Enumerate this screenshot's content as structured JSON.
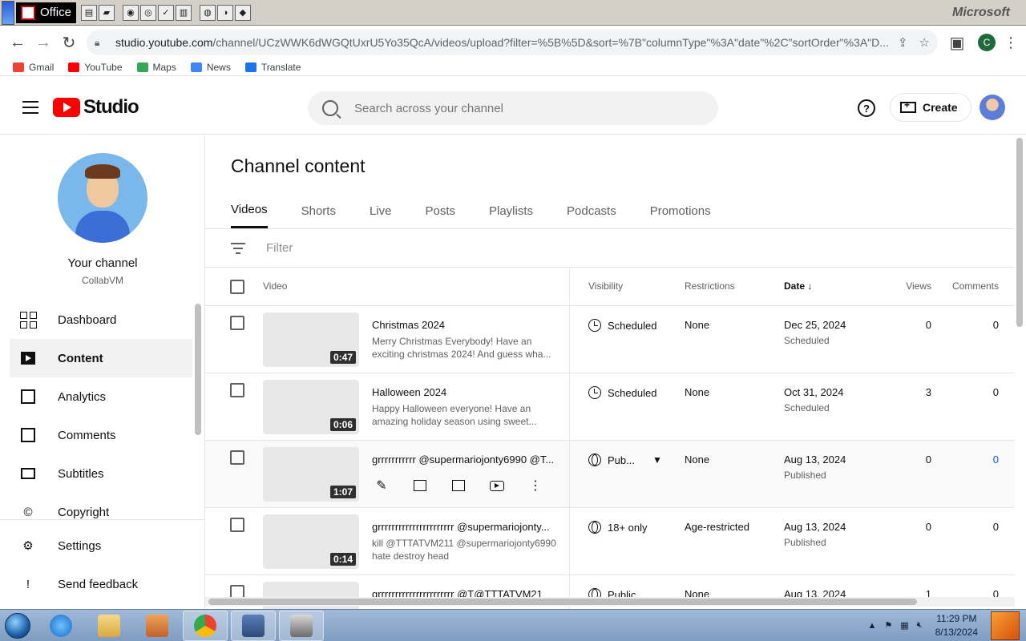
{
  "office": {
    "button_label": "Office",
    "brand": "Microsoft"
  },
  "browser": {
    "url_host": "studio.youtube.com",
    "url_path": "/channel/UCzWWK6dWGQtUxrU5Yo35QcA/videos/upload?filter=%5B%5D&sort=%7B\"columnType\"%3A\"date\"%2C\"sortOrder\"%3A\"D...",
    "profile_initial": "C",
    "bookmarks": [
      "Gmail",
      "YouTube",
      "Maps",
      "News",
      "Translate"
    ]
  },
  "header": {
    "logo_text": "Studio",
    "search_placeholder": "Search across your channel",
    "help": "?",
    "create_label": "Create"
  },
  "sidebar": {
    "channel_name": "Your channel",
    "channel_handle": "CollabVM",
    "items": [
      {
        "label": "Dashboard",
        "icon": "dashboard-icon",
        "active": false
      },
      {
        "label": "Content",
        "icon": "content-icon",
        "active": true
      },
      {
        "label": "Analytics",
        "icon": "analytics-icon",
        "active": false
      },
      {
        "label": "Comments",
        "icon": "comments-icon",
        "active": false
      },
      {
        "label": "Subtitles",
        "icon": "subtitles-icon",
        "active": false
      },
      {
        "label": "Copyright",
        "icon": "copyright-icon",
        "active": false
      }
    ],
    "bottom_items": [
      {
        "label": "Settings",
        "icon": "gear-icon"
      },
      {
        "label": "Send feedback",
        "icon": "feedback-icon"
      }
    ]
  },
  "main": {
    "title": "Channel content",
    "tabs": [
      "Videos",
      "Shorts",
      "Live",
      "Posts",
      "Playlists",
      "Podcasts",
      "Promotions"
    ],
    "active_tab": "Videos",
    "filter_placeholder": "Filter",
    "columns": {
      "video": "Video",
      "visibility": "Visibility",
      "restrictions": "Restrictions",
      "date": "Date",
      "views": "Views",
      "comments": "Comments"
    },
    "rows": [
      {
        "duration": "0:47",
        "title": "Christmas 2024",
        "description": "Merry Christmas Everybody! Have an exciting christmas 2024! And guess wha...",
        "visibility": "Scheduled",
        "restrictions": "None",
        "date": "Dec 25, 2024",
        "date_status": "Scheduled",
        "views": "0",
        "comments": "0"
      },
      {
        "duration": "0:06",
        "title": "Halloween 2024",
        "description": "Happy Halloween everyone! Have an amazing holiday season using sweet...",
        "visibility": "Scheduled",
        "restrictions": "None",
        "date": "Oct 31, 2024",
        "date_status": "Scheduled",
        "views": "3",
        "comments": "0"
      },
      {
        "duration": "1:07",
        "title": "grrrrrrrrrrr @supermariojonty6990 @T...",
        "description": "",
        "visibility": "Pub...",
        "restrictions": "None",
        "date": "Aug 13, 2024",
        "date_status": "Published",
        "views": "0",
        "comments": "0"
      },
      {
        "duration": "0:14",
        "title": "grrrrrrrrrrrrrrrrrrrrrr @supermariojonty...",
        "description": "kill @TTTATVM211 @supermariojonty6990 hate destroy head",
        "visibility": "18+ only",
        "restrictions": "Age-restricted",
        "date": "Aug 13, 2024",
        "date_status": "Published",
        "views": "0",
        "comments": "0"
      },
      {
        "duration": "",
        "title": "grrrrrrrrrrrrrrrrrrrrrr @T@TTTATVM21",
        "description": "",
        "visibility": "Public",
        "restrictions": "None",
        "date": "Aug 13, 2024",
        "date_status": "",
        "views": "1",
        "comments": "0"
      }
    ]
  },
  "taskbar": {
    "time": "11:29 PM",
    "date": "8/13/2024"
  }
}
